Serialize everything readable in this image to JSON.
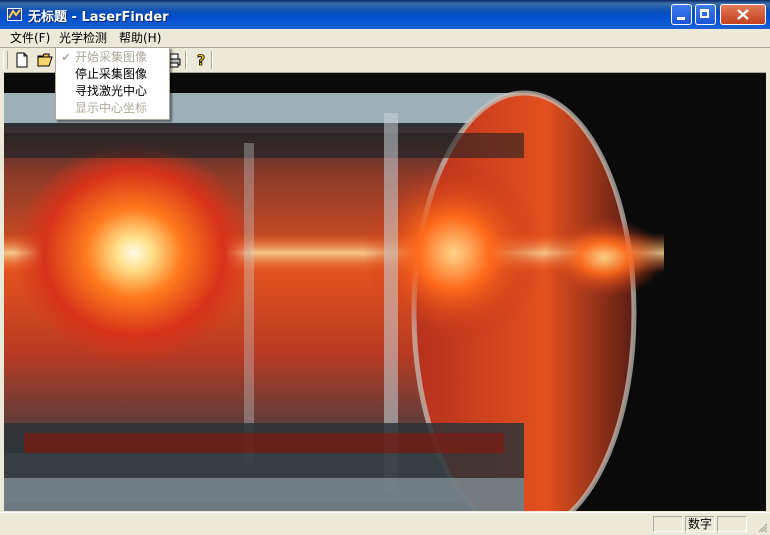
{
  "window": {
    "title": "无标题 - LaserFinder"
  },
  "menubar": {
    "items": [
      "文件(F)",
      "光学检测",
      "帮助(H)"
    ]
  },
  "dropdown": {
    "items": [
      {
        "label": "开始采集图像",
        "enabled": false,
        "checked": true
      },
      {
        "label": "停止采集图像",
        "enabled": true,
        "checked": false
      },
      {
        "label": "寻找激光中心",
        "enabled": true,
        "checked": false
      },
      {
        "label": "显示中心坐标",
        "enabled": false,
        "checked": false
      }
    ]
  },
  "toolbar": {
    "buttons": [
      "new-icon",
      "open-icon",
      "print-icon",
      "help-icon"
    ]
  },
  "statusbar": {
    "numlock": "数字"
  },
  "colors": {
    "titlebar": "#0050d0",
    "menu_disabled": "#aca899",
    "background": "#ece9d8"
  }
}
